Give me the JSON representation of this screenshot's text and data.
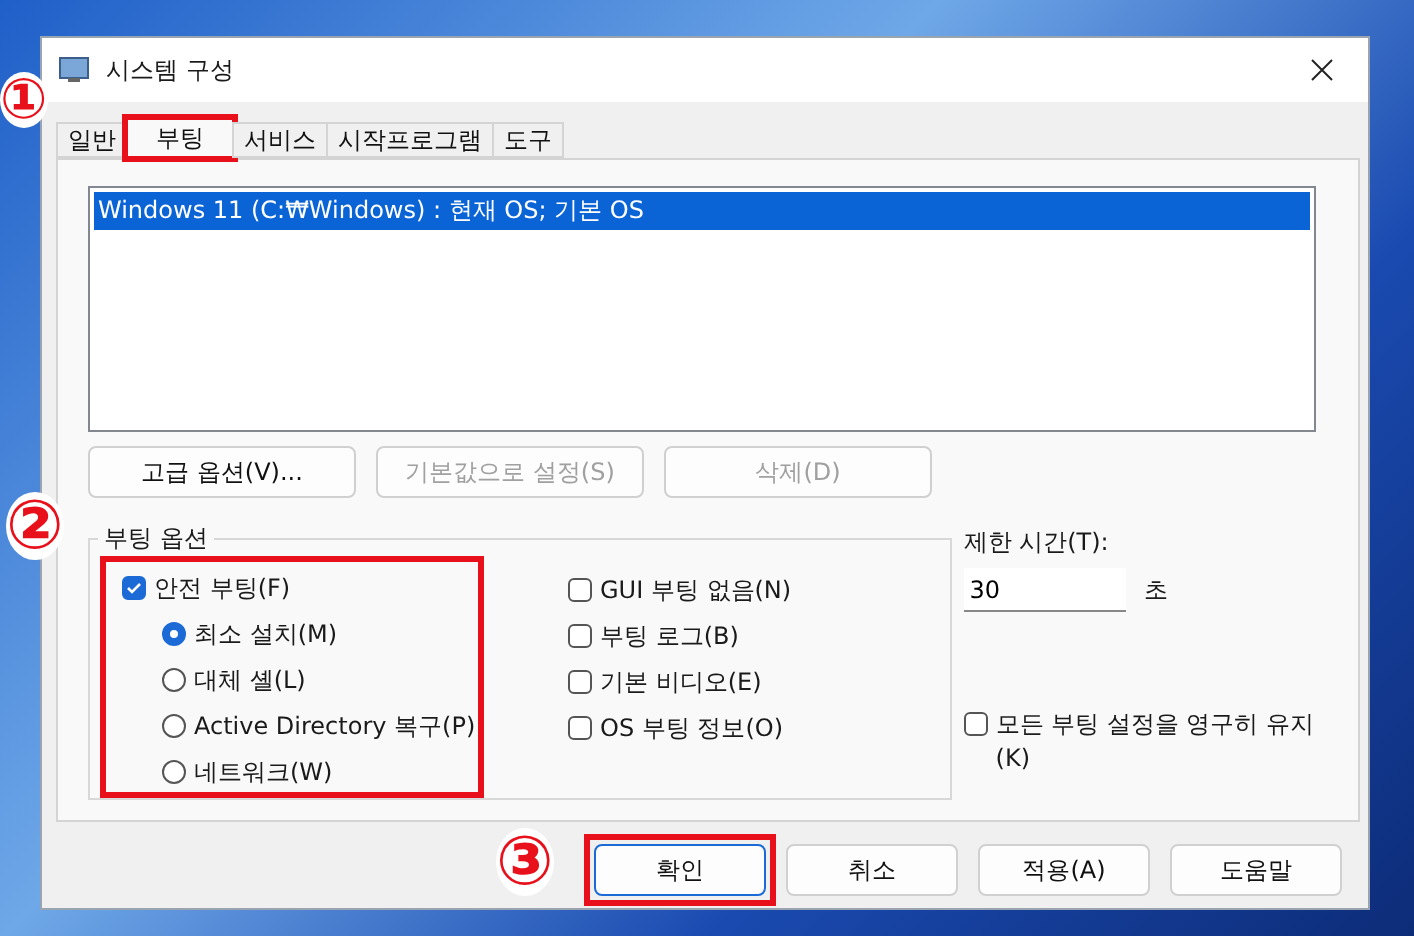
{
  "window": {
    "title": "시스템 구성"
  },
  "tabs": [
    {
      "label": "일반",
      "selected": false,
      "highlighted": false
    },
    {
      "label": "부팅",
      "selected": true,
      "highlighted": true
    },
    {
      "label": "서비스",
      "selected": false,
      "highlighted": false
    },
    {
      "label": "시작프로그램",
      "selected": false,
      "highlighted": false
    },
    {
      "label": "도구",
      "selected": false,
      "highlighted": false
    }
  ],
  "boot_list": {
    "items": [
      {
        "label": "Windows 11 (C:₩Windows) : 현재 OS; 기본 OS",
        "selected": true
      }
    ]
  },
  "list_buttons": [
    {
      "label": "고급 옵션(V)...",
      "disabled": false
    },
    {
      "label": "기본값으로 설정(S)",
      "disabled": true
    },
    {
      "label": "삭제(D)",
      "disabled": true
    }
  ],
  "boot_options": {
    "title": "부팅 옵션",
    "highlighted": true,
    "safe_boot": {
      "label": "안전 부팅(F)",
      "checked": true
    },
    "modes": [
      {
        "label": "최소 설치(M)",
        "selected": true
      },
      {
        "label": "대체 셸(L)",
        "selected": false
      },
      {
        "label": "Active Directory 복구(P)",
        "selected": false
      },
      {
        "label": "네트워크(W)",
        "selected": false
      }
    ],
    "flags": [
      {
        "label": "GUI 부팅 없음(N)",
        "checked": false
      },
      {
        "label": "부팅 로그(B)",
        "checked": false
      },
      {
        "label": "기본 비디오(E)",
        "checked": false
      },
      {
        "label": "OS 부팅 정보(O)",
        "checked": false
      }
    ]
  },
  "timeout": {
    "label": "제한 시간(T):",
    "value": "30",
    "unit": "초"
  },
  "persist": {
    "label": "모든 부팅 설정을 영구히 유지(K)",
    "checked": false
  },
  "footer_buttons": [
    {
      "label": "확인",
      "default": true,
      "highlighted": true
    },
    {
      "label": "취소",
      "default": false,
      "highlighted": false
    },
    {
      "label": "적용(A)",
      "default": false,
      "highlighted": false
    },
    {
      "label": "도움말",
      "default": false,
      "highlighted": false
    }
  ],
  "annotations": [
    {
      "marker": "①"
    },
    {
      "marker": "②"
    },
    {
      "marker": "③"
    }
  ]
}
